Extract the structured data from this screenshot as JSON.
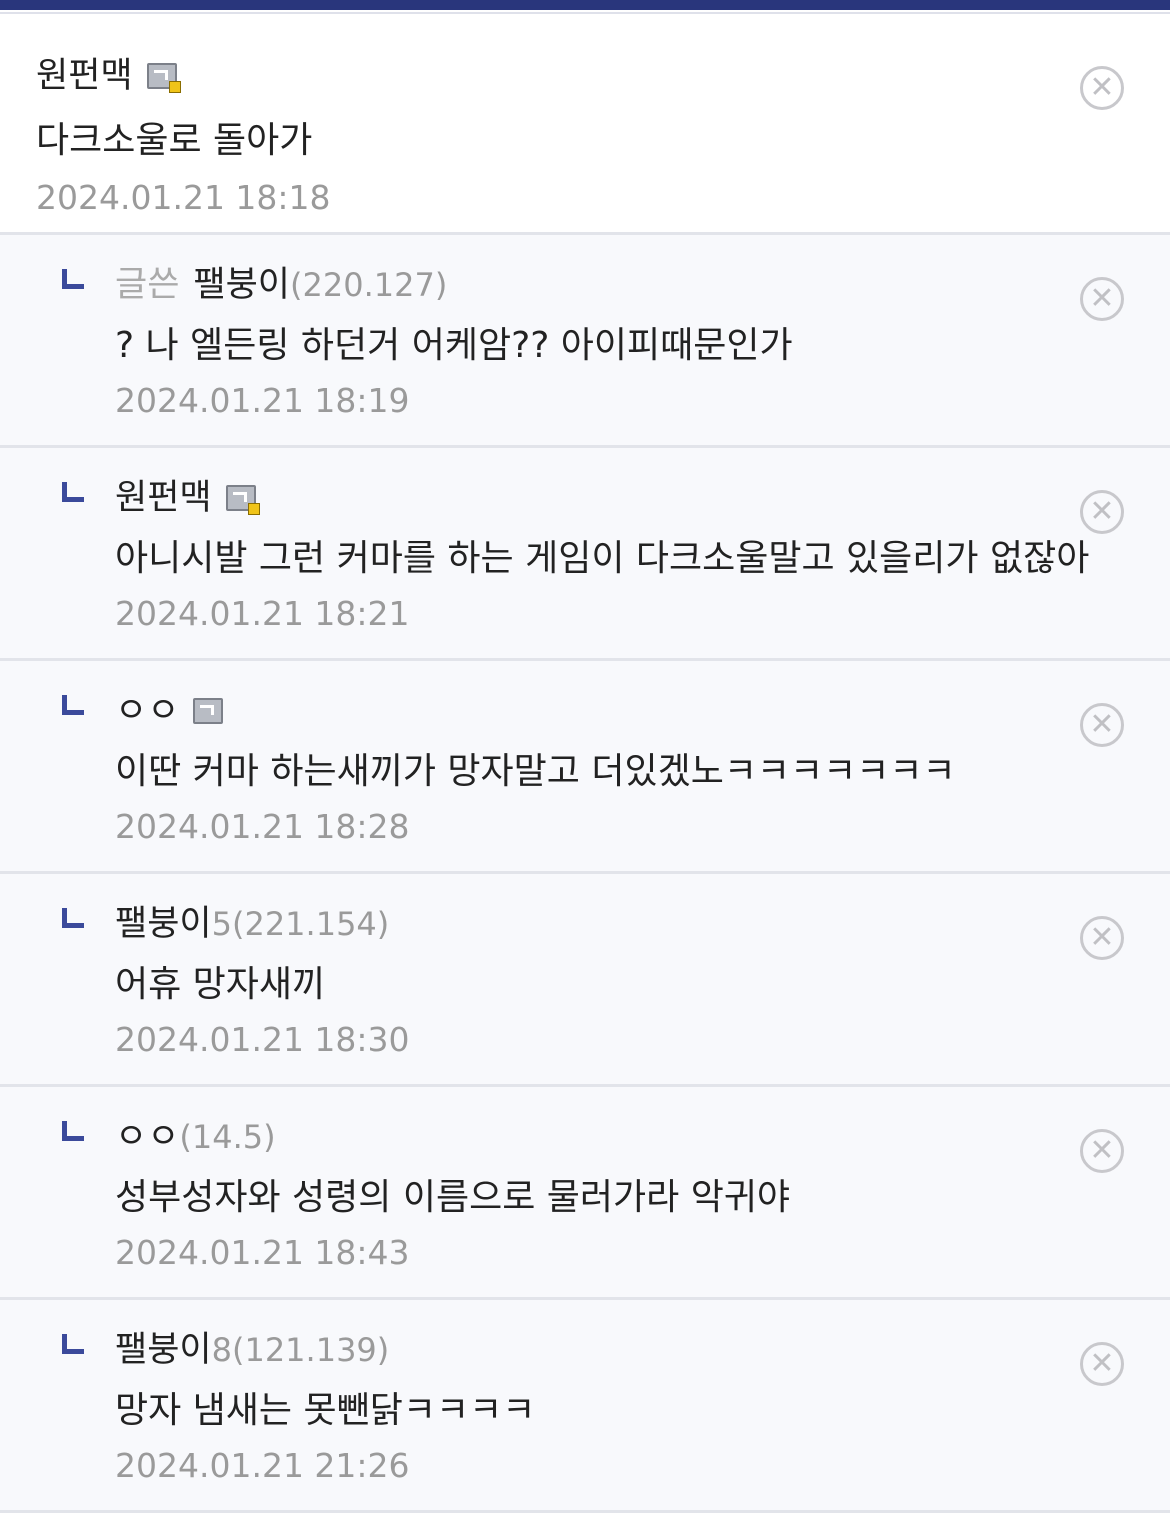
{
  "comments": [
    {
      "nick": "원펀맥",
      "ip": "",
      "has_gallog_icon": true,
      "text": "다크소울로 돌아가",
      "date": "2024.01.21 18:18"
    }
  ],
  "replies": [
    {
      "writer_tag": "글쓴",
      "nick": "팰붕이",
      "ip": "(220.127)",
      "text": "? 나 엘든링 하던거 어케암?? 아이피때문인가",
      "date": "2024.01.21 18:19"
    },
    {
      "nick": "원펀맥",
      "ip": "",
      "text": "아니시발 그런 커마를 하는 게임이 다크소울말고 있을리가 없잖아",
      "date": "2024.01.21 18:21"
    },
    {
      "nick": "ㅇㅇ",
      "ip": "",
      "text": "이딴 커마 하는새끼가 망자말고 더있겠노ㅋㅋㅋㅋㅋㅋㅋ",
      "date": "2024.01.21 18:28"
    },
    {
      "nick": "팰붕이",
      "suffix": "5",
      "ip": "(221.154)",
      "text": "어휴 망자새끼",
      "date": "2024.01.21 18:30"
    },
    {
      "nick": "ㅇㅇ",
      "ip": "(14.5)",
      "text": "성부성자와 성령의 이름으로 물러가라 악귀야",
      "date": "2024.01.21 18:43"
    },
    {
      "nick": "팰붕이",
      "suffix": "8",
      "ip": "(121.139)",
      "text": "망자 냄새는 못뺀닭ㅋㅋㅋㅋ",
      "date": "2024.01.21 21:26"
    }
  ],
  "delete_symbol": "✕",
  "icons": {
    "reply": "reply-arrow-icon",
    "gallog": "gallog-icon",
    "delete": "delete-circle-icon"
  },
  "colors": {
    "topbar": "#29367c",
    "reply_mark": "#3b4a9b",
    "reply_bg": "#f8f9fc",
    "muted": "#9a9a9a"
  }
}
